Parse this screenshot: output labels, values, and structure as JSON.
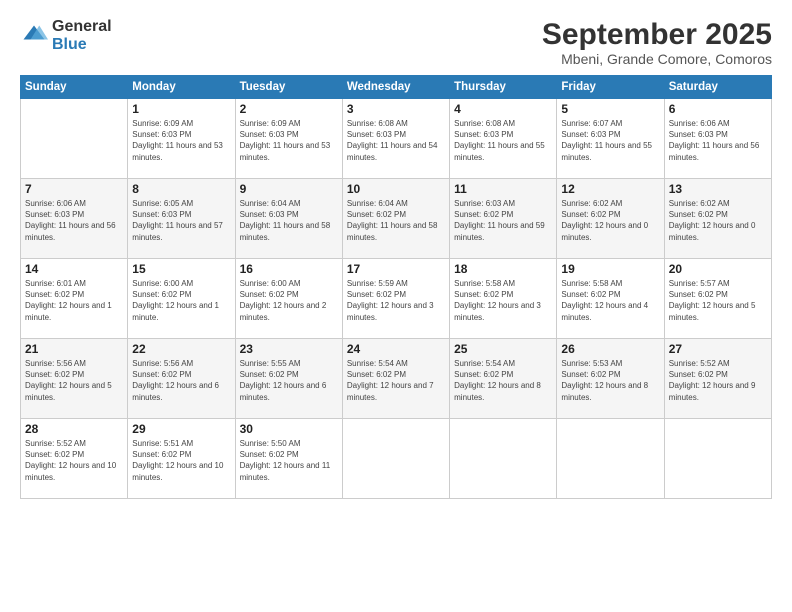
{
  "logo": {
    "general": "General",
    "blue": "Blue"
  },
  "header": {
    "title": "September 2025",
    "location": "Mbeni, Grande Comore, Comoros"
  },
  "columns": [
    "Sunday",
    "Monday",
    "Tuesday",
    "Wednesday",
    "Thursday",
    "Friday",
    "Saturday"
  ],
  "weeks": [
    [
      {
        "day": "",
        "sunrise": "",
        "sunset": "",
        "daylight": ""
      },
      {
        "day": "1",
        "sunrise": "Sunrise: 6:09 AM",
        "sunset": "Sunset: 6:03 PM",
        "daylight": "Daylight: 11 hours and 53 minutes."
      },
      {
        "day": "2",
        "sunrise": "Sunrise: 6:09 AM",
        "sunset": "Sunset: 6:03 PM",
        "daylight": "Daylight: 11 hours and 53 minutes."
      },
      {
        "day": "3",
        "sunrise": "Sunrise: 6:08 AM",
        "sunset": "Sunset: 6:03 PM",
        "daylight": "Daylight: 11 hours and 54 minutes."
      },
      {
        "day": "4",
        "sunrise": "Sunrise: 6:08 AM",
        "sunset": "Sunset: 6:03 PM",
        "daylight": "Daylight: 11 hours and 55 minutes."
      },
      {
        "day": "5",
        "sunrise": "Sunrise: 6:07 AM",
        "sunset": "Sunset: 6:03 PM",
        "daylight": "Daylight: 11 hours and 55 minutes."
      },
      {
        "day": "6",
        "sunrise": "Sunrise: 6:06 AM",
        "sunset": "Sunset: 6:03 PM",
        "daylight": "Daylight: 11 hours and 56 minutes."
      }
    ],
    [
      {
        "day": "7",
        "sunrise": "Sunrise: 6:06 AM",
        "sunset": "Sunset: 6:03 PM",
        "daylight": "Daylight: 11 hours and 56 minutes."
      },
      {
        "day": "8",
        "sunrise": "Sunrise: 6:05 AM",
        "sunset": "Sunset: 6:03 PM",
        "daylight": "Daylight: 11 hours and 57 minutes."
      },
      {
        "day": "9",
        "sunrise": "Sunrise: 6:04 AM",
        "sunset": "Sunset: 6:03 PM",
        "daylight": "Daylight: 11 hours and 58 minutes."
      },
      {
        "day": "10",
        "sunrise": "Sunrise: 6:04 AM",
        "sunset": "Sunset: 6:02 PM",
        "daylight": "Daylight: 11 hours and 58 minutes."
      },
      {
        "day": "11",
        "sunrise": "Sunrise: 6:03 AM",
        "sunset": "Sunset: 6:02 PM",
        "daylight": "Daylight: 11 hours and 59 minutes."
      },
      {
        "day": "12",
        "sunrise": "Sunrise: 6:02 AM",
        "sunset": "Sunset: 6:02 PM",
        "daylight": "Daylight: 12 hours and 0 minutes."
      },
      {
        "day": "13",
        "sunrise": "Sunrise: 6:02 AM",
        "sunset": "Sunset: 6:02 PM",
        "daylight": "Daylight: 12 hours and 0 minutes."
      }
    ],
    [
      {
        "day": "14",
        "sunrise": "Sunrise: 6:01 AM",
        "sunset": "Sunset: 6:02 PM",
        "daylight": "Daylight: 12 hours and 1 minute."
      },
      {
        "day": "15",
        "sunrise": "Sunrise: 6:00 AM",
        "sunset": "Sunset: 6:02 PM",
        "daylight": "Daylight: 12 hours and 1 minute."
      },
      {
        "day": "16",
        "sunrise": "Sunrise: 6:00 AM",
        "sunset": "Sunset: 6:02 PM",
        "daylight": "Daylight: 12 hours and 2 minutes."
      },
      {
        "day": "17",
        "sunrise": "Sunrise: 5:59 AM",
        "sunset": "Sunset: 6:02 PM",
        "daylight": "Daylight: 12 hours and 3 minutes."
      },
      {
        "day": "18",
        "sunrise": "Sunrise: 5:58 AM",
        "sunset": "Sunset: 6:02 PM",
        "daylight": "Daylight: 12 hours and 3 minutes."
      },
      {
        "day": "19",
        "sunrise": "Sunrise: 5:58 AM",
        "sunset": "Sunset: 6:02 PM",
        "daylight": "Daylight: 12 hours and 4 minutes."
      },
      {
        "day": "20",
        "sunrise": "Sunrise: 5:57 AM",
        "sunset": "Sunset: 6:02 PM",
        "daylight": "Daylight: 12 hours and 5 minutes."
      }
    ],
    [
      {
        "day": "21",
        "sunrise": "Sunrise: 5:56 AM",
        "sunset": "Sunset: 6:02 PM",
        "daylight": "Daylight: 12 hours and 5 minutes."
      },
      {
        "day": "22",
        "sunrise": "Sunrise: 5:56 AM",
        "sunset": "Sunset: 6:02 PM",
        "daylight": "Daylight: 12 hours and 6 minutes."
      },
      {
        "day": "23",
        "sunrise": "Sunrise: 5:55 AM",
        "sunset": "Sunset: 6:02 PM",
        "daylight": "Daylight: 12 hours and 6 minutes."
      },
      {
        "day": "24",
        "sunrise": "Sunrise: 5:54 AM",
        "sunset": "Sunset: 6:02 PM",
        "daylight": "Daylight: 12 hours and 7 minutes."
      },
      {
        "day": "25",
        "sunrise": "Sunrise: 5:54 AM",
        "sunset": "Sunset: 6:02 PM",
        "daylight": "Daylight: 12 hours and 8 minutes."
      },
      {
        "day": "26",
        "sunrise": "Sunrise: 5:53 AM",
        "sunset": "Sunset: 6:02 PM",
        "daylight": "Daylight: 12 hours and 8 minutes."
      },
      {
        "day": "27",
        "sunrise": "Sunrise: 5:52 AM",
        "sunset": "Sunset: 6:02 PM",
        "daylight": "Daylight: 12 hours and 9 minutes."
      }
    ],
    [
      {
        "day": "28",
        "sunrise": "Sunrise: 5:52 AM",
        "sunset": "Sunset: 6:02 PM",
        "daylight": "Daylight: 12 hours and 10 minutes."
      },
      {
        "day": "29",
        "sunrise": "Sunrise: 5:51 AM",
        "sunset": "Sunset: 6:02 PM",
        "daylight": "Daylight: 12 hours and 10 minutes."
      },
      {
        "day": "30",
        "sunrise": "Sunrise: 5:50 AM",
        "sunset": "Sunset: 6:02 PM",
        "daylight": "Daylight: 12 hours and 11 minutes."
      },
      {
        "day": "",
        "sunrise": "",
        "sunset": "",
        "daylight": ""
      },
      {
        "day": "",
        "sunrise": "",
        "sunset": "",
        "daylight": ""
      },
      {
        "day": "",
        "sunrise": "",
        "sunset": "",
        "daylight": ""
      },
      {
        "day": "",
        "sunrise": "",
        "sunset": "",
        "daylight": ""
      }
    ]
  ]
}
